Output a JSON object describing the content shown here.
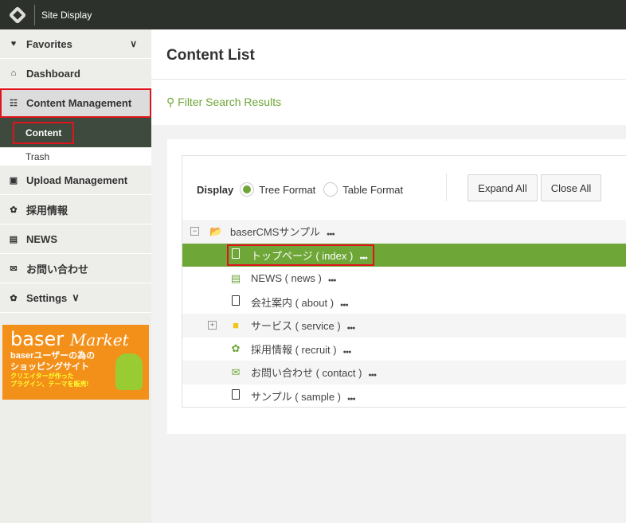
{
  "topbar": {
    "site_display": "Site Display"
  },
  "sidebar": {
    "favorites": "Favorites",
    "dashboard": "Dashboard",
    "content_management": "Content Management",
    "content": "Content",
    "trash": "Trash",
    "upload_management": "Upload Management",
    "recruit": "採用情報",
    "news": "NEWS",
    "contact": "お問い合わせ",
    "settings": "Settings"
  },
  "banner": {
    "brand": "baser",
    "brand2": "Market",
    "line1": "baserユーザーの為の",
    "line2": "ショッピングサイト",
    "line3": "クリエイターが作った",
    "line4": "プラグイン、テーマを販売!"
  },
  "page": {
    "title": "Content List",
    "filter": "Filter Search Results"
  },
  "display": {
    "label": "Display",
    "options": [
      "Tree Format",
      "Table Format"
    ],
    "selected": "Tree Format",
    "expand_all": "Expand All",
    "close_all": "Close All"
  },
  "tree": [
    {
      "label": "baserCMSサンプル",
      "icon": "folder-open",
      "toggle": "minus"
    },
    {
      "label": "トップページ ( index )",
      "icon": "page",
      "selected": true
    },
    {
      "label": "NEWS ( news )",
      "icon": "blog"
    },
    {
      "label": "会社案内 ( about )",
      "icon": "page"
    },
    {
      "label": "サービス ( service )",
      "icon": "folder",
      "toggle": "plus"
    },
    {
      "label": "採用情報 ( recruit )",
      "icon": "gear"
    },
    {
      "label": "お問い合わせ ( contact )",
      "icon": "mail"
    },
    {
      "label": "サンプル ( sample )",
      "icon": "page"
    }
  ],
  "colors": {
    "accent": "#6ea637",
    "highlight": "#e0141c",
    "topbar": "#2c312b"
  }
}
